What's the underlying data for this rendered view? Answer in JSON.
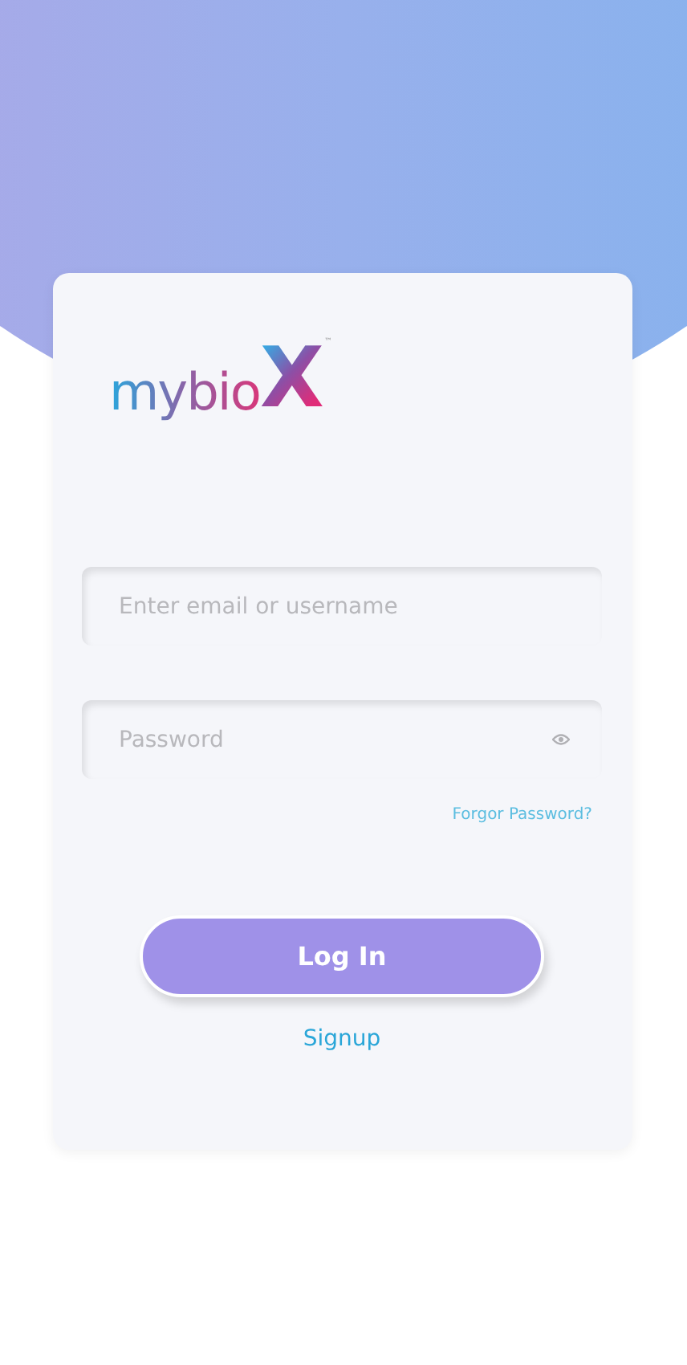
{
  "logo": {
    "text": "mybio",
    "mark": "X",
    "trademark": "™"
  },
  "fields": [
    {
      "kind": "text",
      "placeholder": "Enter email or username"
    },
    {
      "kind": "password",
      "placeholder": "Password"
    }
  ],
  "forgot_link": "Forgor Password?",
  "login_button": "Log In",
  "signup_link": "Signup"
}
